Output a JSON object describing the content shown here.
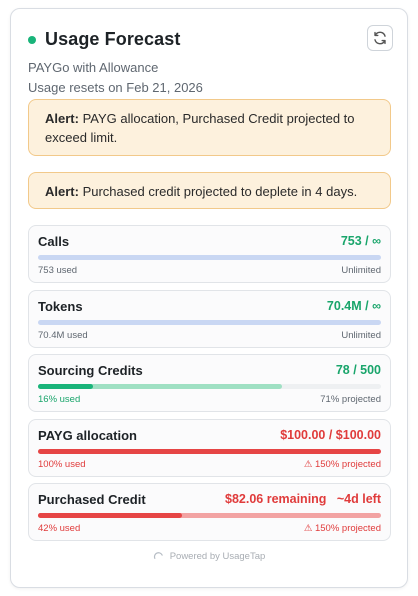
{
  "header": {
    "title": "Usage Forecast",
    "plan": "PAYGo with Allowance",
    "reset_text": "Usage resets on Feb 21, 2026",
    "status_color": "#19b47a",
    "refresh_icon": "refresh-icon"
  },
  "alerts": [
    {
      "label": "Alert:",
      "text": "PAYG allocation, Purchased Credit projected to exceed limit."
    },
    {
      "label": "Alert:",
      "text": "Purchased credit projected to deplete in 4 days."
    }
  ],
  "metrics": [
    {
      "name": "Calls",
      "value": "753 / ∞",
      "left_note": "753 used",
      "right_note": "Unlimited",
      "used_fraction": 1.0,
      "projected_fraction": 1.0
    },
    {
      "name": "Tokens",
      "value": "70.4M / ∞",
      "left_note": "70.4M used",
      "right_note": "Unlimited",
      "used_fraction": 1.0,
      "projected_fraction": 1.0
    },
    {
      "name": "Sourcing Credits",
      "value": "78 / 500",
      "left_note": "16% used",
      "right_note": "71% projected",
      "used_fraction": 0.16,
      "projected_fraction": 0.71
    },
    {
      "name": "PAYG allocation",
      "value": "$100.00 / $100.00",
      "left_note": "100% used",
      "right_note": "⚠ 150% projected",
      "used_fraction": 1.0,
      "projected_fraction": 1.0
    },
    {
      "name": "Purchased Credit",
      "value": "$82.06 remaining",
      "value_extra": "~4d left",
      "left_note": "42% used",
      "right_note": "⚠ 150% projected",
      "used_fraction": 0.42,
      "projected_fraction": 1.0
    }
  ],
  "footer": {
    "powered_by": "Powered by UsageTap"
  },
  "colors": {
    "unlimited": "#c9d7f3",
    "green": "#19b47a",
    "green_projected": "#9fe0c3",
    "red": "#e64545",
    "red_projected": "#f2a3a3"
  }
}
